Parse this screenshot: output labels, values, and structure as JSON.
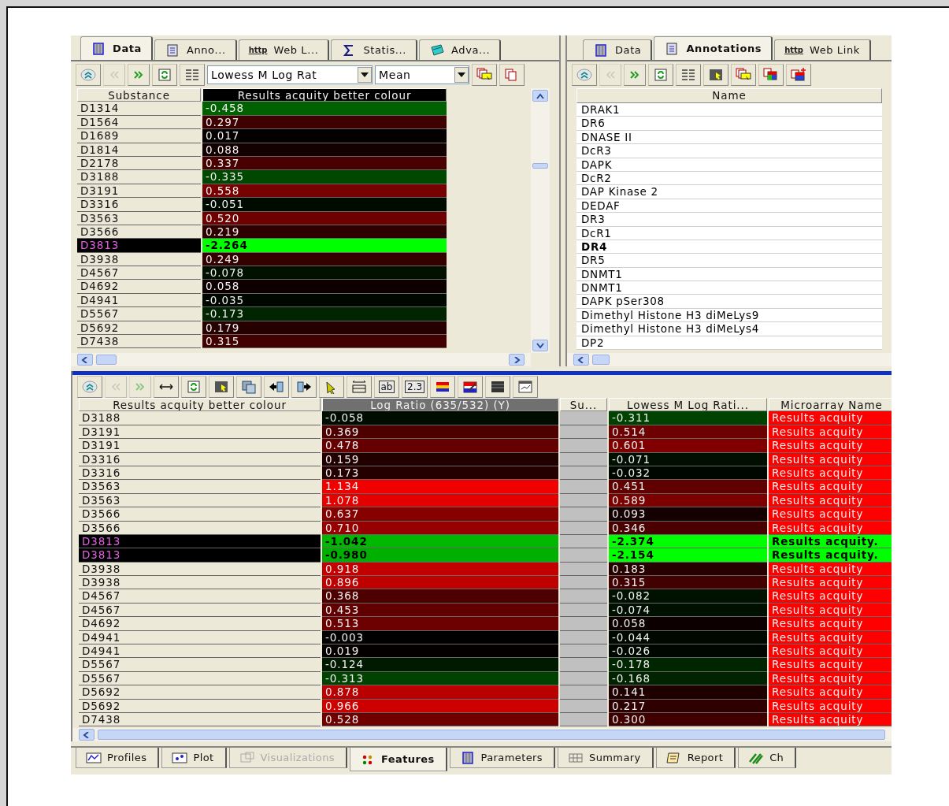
{
  "top_left": {
    "tabs": [
      {
        "label": "Data",
        "selected": true
      },
      {
        "label": "Anno...",
        "selected": false
      },
      {
        "label": "Web L...",
        "badge": "http",
        "selected": false
      },
      {
        "label": "Statis...",
        "selected": false
      },
      {
        "label": "Adva...",
        "selected": false
      }
    ],
    "toolbar": [
      {
        "kind": "expand",
        "disabled": false
      },
      {
        "kind": "prev",
        "disabled": true
      },
      {
        "kind": "next",
        "disabled": false
      },
      {
        "kind": "refresh",
        "disabled": false
      },
      {
        "kind": "columns",
        "disabled": false
      },
      {
        "kind": "select",
        "value": "Lowess M Log Rat",
        "disabled": false
      },
      {
        "kind": "select",
        "value": "Mean",
        "disabled": false
      },
      {
        "kind": "cards-filter",
        "disabled": false
      },
      {
        "kind": "cards",
        "disabled": false
      }
    ],
    "columns": [
      {
        "label": "Substance"
      },
      {
        "label": "Results acquity better colour",
        "color": "#000000"
      }
    ],
    "rows": [
      {
        "substance": "D1314",
        "value": "-0.458",
        "color": "#006100",
        "selected": false
      },
      {
        "substance": "D1564",
        "value": "0.297",
        "color": "#3f0000",
        "selected": false
      },
      {
        "substance": "D1689",
        "value": "0.017",
        "color": "#040000",
        "selected": false
      },
      {
        "substance": "D1814",
        "value": "0.088",
        "color": "#130000",
        "selected": false
      },
      {
        "substance": "D2178",
        "value": "0.337",
        "color": "#480000",
        "selected": false
      },
      {
        "substance": "D3188",
        "value": "-0.335",
        "color": "#004700",
        "selected": false
      },
      {
        "substance": "D3191",
        "value": "0.558",
        "color": "#770000",
        "selected": false
      },
      {
        "substance": "D3316",
        "value": "-0.051",
        "color": "#000b00",
        "selected": false
      },
      {
        "substance": "D3563",
        "value": "0.520",
        "color": "#6f0000",
        "selected": false
      },
      {
        "substance": "D3566",
        "value": "0.219",
        "color": "#2f0000",
        "selected": false
      },
      {
        "substance": "D3813",
        "value": "-2.264",
        "color": "#00ff00",
        "selected": true
      },
      {
        "substance": "D3938",
        "value": "0.249",
        "color": "#350000",
        "selected": false
      },
      {
        "substance": "D4567",
        "value": "-0.078",
        "color": "#001100",
        "selected": false
      },
      {
        "substance": "D4692",
        "value": "0.058",
        "color": "#0c0000",
        "selected": false
      },
      {
        "substance": "D4941",
        "value": "-0.035",
        "color": "#000700",
        "selected": false
      },
      {
        "substance": "D5567",
        "value": "-0.173",
        "color": "#002500",
        "selected": false
      },
      {
        "substance": "D5692",
        "value": "0.179",
        "color": "#260000",
        "selected": false
      },
      {
        "substance": "D7438",
        "value": "0.315",
        "color": "#430000",
        "selected": false
      }
    ]
  },
  "top_right": {
    "tabs": [
      {
        "label": "Data",
        "selected": false
      },
      {
        "label": "Annotations",
        "selected": true
      },
      {
        "label": "Web Link",
        "badge": "http",
        "selected": false
      }
    ],
    "toolbar": [
      {
        "kind": "expand",
        "disabled": false
      },
      {
        "kind": "prev",
        "disabled": true
      },
      {
        "kind": "next",
        "disabled": false
      },
      {
        "kind": "refresh",
        "disabled": false
      },
      {
        "kind": "columns",
        "disabled": false
      },
      {
        "kind": "column-pick",
        "disabled": false
      },
      {
        "kind": "cards-filter",
        "disabled": false
      },
      {
        "kind": "cards-color",
        "disabled": false
      },
      {
        "kind": "cards-color-add",
        "disabled": false
      }
    ],
    "column": "Name",
    "rows": [
      {
        "name": "DRAK1",
        "selected": false
      },
      {
        "name": "DR6",
        "selected": false
      },
      {
        "name": "DNASE II",
        "selected": false
      },
      {
        "name": "DcR3",
        "selected": false
      },
      {
        "name": "DAPK",
        "selected": false
      },
      {
        "name": "DcR2",
        "selected": false
      },
      {
        "name": "DAP Kinase 2",
        "selected": false
      },
      {
        "name": "DEDAF",
        "selected": false
      },
      {
        "name": "DR3",
        "selected": false
      },
      {
        "name": "DcR1",
        "selected": false
      },
      {
        "name": "DR4",
        "selected": true
      },
      {
        "name": "DR5",
        "selected": false
      },
      {
        "name": "DNMT1",
        "selected": false
      },
      {
        "name": "DNMT1",
        "selected": false
      },
      {
        "name": "DAPK pSer308",
        "selected": false
      },
      {
        "name": "Dimethyl Histone H3 diMeLys9",
        "selected": false
      },
      {
        "name": "Dimethyl Histone H3 diMeLys4",
        "selected": false
      },
      {
        "name": "DP2",
        "selected": false
      }
    ]
  },
  "bottom": {
    "toolbar": [
      {
        "kind": "expand",
        "disabled": false
      },
      {
        "kind": "prev",
        "disabled": true
      },
      {
        "kind": "next",
        "disabled": true
      },
      {
        "kind": "arrows",
        "disabled": false
      },
      {
        "kind": "refresh",
        "disabled": false
      },
      {
        "kind": "column-pick",
        "disabled": false
      },
      {
        "kind": "copy",
        "disabled": false
      },
      {
        "kind": "move-left",
        "disabled": false
      },
      {
        "kind": "move-right",
        "disabled": false
      },
      {
        "kind": "pointer",
        "disabled": false
      },
      {
        "kind": "fit-width",
        "disabled": false
      },
      {
        "kind": "label",
        "text": "ab",
        "disabled": false
      },
      {
        "kind": "label",
        "text": "2.3",
        "disabled": false
      },
      {
        "kind": "colors",
        "disabled": false
      },
      {
        "kind": "pen",
        "disabled": false
      },
      {
        "kind": "dark-rows",
        "disabled": false
      },
      {
        "kind": "chart",
        "disabled": false
      }
    ],
    "columns": [
      {
        "label": "Results acquity better colour"
      },
      {
        "label": "Log Ratio (635/532) (Y)",
        "color": "#707070"
      },
      {
        "label": "Su..."
      },
      {
        "label": "Lowess M Log Rati..."
      },
      {
        "label": "Microarray Name"
      }
    ],
    "rows": [
      {
        "name": "D3188",
        "log_ratio": {
          "text": "-0.058",
          "color": "#000c00"
        },
        "lowess": {
          "text": "-0.311",
          "color": "#004200"
        },
        "microarray": {
          "text": "Results acquity",
          "color": "#ff0000"
        },
        "selected": false
      },
      {
        "name": "D3191",
        "log_ratio": {
          "text": "0.369",
          "color": "#4e0000"
        },
        "lowess": {
          "text": "0.514",
          "color": "#6d0000"
        },
        "microarray": {
          "text": "Results acquity",
          "color": "#ff0000"
        },
        "selected": false
      },
      {
        "name": "D3191",
        "log_ratio": {
          "text": "0.478",
          "color": "#660000"
        },
        "lowess": {
          "text": "0.601",
          "color": "#800000"
        },
        "microarray": {
          "text": "Results acquity",
          "color": "#ff0000"
        },
        "selected": false
      },
      {
        "name": "D3316",
        "log_ratio": {
          "text": "0.159",
          "color": "#220000"
        },
        "lowess": {
          "text": "-0.071",
          "color": "#000f00"
        },
        "microarray": {
          "text": "Results acquity",
          "color": "#ff0000"
        },
        "selected": false
      },
      {
        "name": "D3316",
        "log_ratio": {
          "text": "0.173",
          "color": "#250000"
        },
        "lowess": {
          "text": "-0.032",
          "color": "#000700"
        },
        "microarray": {
          "text": "Results acquity",
          "color": "#ff0000"
        },
        "selected": false
      },
      {
        "name": "D3563",
        "log_ratio": {
          "text": "1.134",
          "color": "#f10000"
        },
        "lowess": {
          "text": "0.451",
          "color": "#600000"
        },
        "microarray": {
          "text": "Results acquity",
          "color": "#ff0000"
        },
        "selected": false
      },
      {
        "name": "D3563",
        "log_ratio": {
          "text": "1.078",
          "color": "#e50000"
        },
        "lowess": {
          "text": "0.589",
          "color": "#7d0000"
        },
        "microarray": {
          "text": "Results acquity",
          "color": "#ff0000"
        },
        "selected": false
      },
      {
        "name": "D3566",
        "log_ratio": {
          "text": "0.637",
          "color": "#870000"
        },
        "lowess": {
          "text": "0.093",
          "color": "#140000"
        },
        "microarray": {
          "text": "Results acquity",
          "color": "#ff0000"
        },
        "selected": false
      },
      {
        "name": "D3566",
        "log_ratio": {
          "text": "0.710",
          "color": "#970000"
        },
        "lowess": {
          "text": "0.346",
          "color": "#4a0000"
        },
        "microarray": {
          "text": "Results acquity",
          "color": "#ff0000"
        },
        "selected": false
      },
      {
        "name": "D3813",
        "log_ratio": {
          "text": "-1.042",
          "color": "#00b800"
        },
        "lowess": {
          "text": "-2.374",
          "color": "#00ff00"
        },
        "microarray": {
          "text": "Results acquity.",
          "color": "#00ff00"
        },
        "selected": true
      },
      {
        "name": "D3813",
        "log_ratio": {
          "text": "-0.980",
          "color": "#00b000"
        },
        "lowess": {
          "text": "-2.154",
          "color": "#00ff00"
        },
        "microarray": {
          "text": "Results acquity.",
          "color": "#00ff00"
        },
        "selected": true
      },
      {
        "name": "D3938",
        "log_ratio": {
          "text": "0.918",
          "color": "#c30000"
        },
        "lowess": {
          "text": "0.183",
          "color": "#270000"
        },
        "microarray": {
          "text": "Results acquity",
          "color": "#ff0000"
        },
        "selected": false
      },
      {
        "name": "D3938",
        "log_ratio": {
          "text": "0.896",
          "color": "#be0000"
        },
        "lowess": {
          "text": "0.315",
          "color": "#430000"
        },
        "microarray": {
          "text": "Results acquity",
          "color": "#ff0000"
        },
        "selected": false
      },
      {
        "name": "D4567",
        "log_ratio": {
          "text": "0.368",
          "color": "#4e0000"
        },
        "lowess": {
          "text": "-0.082",
          "color": "#001100"
        },
        "microarray": {
          "text": "Results acquity",
          "color": "#ff0000"
        },
        "selected": false
      },
      {
        "name": "D4567",
        "log_ratio": {
          "text": "0.453",
          "color": "#600000"
        },
        "lowess": {
          "text": "-0.074",
          "color": "#001000"
        },
        "microarray": {
          "text": "Results acquity",
          "color": "#ff0000"
        },
        "selected": false
      },
      {
        "name": "D4692",
        "log_ratio": {
          "text": "0.513",
          "color": "#6d0000"
        },
        "lowess": {
          "text": "0.058",
          "color": "#0c0000"
        },
        "microarray": {
          "text": "Results acquity",
          "color": "#ff0000"
        },
        "selected": false
      },
      {
        "name": "D4941",
        "log_ratio": {
          "text": "-0.003",
          "color": "#000100"
        },
        "lowess": {
          "text": "-0.044",
          "color": "#000900"
        },
        "microarray": {
          "text": "Results acquity",
          "color": "#ff0000"
        },
        "selected": false
      },
      {
        "name": "D4941",
        "log_ratio": {
          "text": "0.019",
          "color": "#040000"
        },
        "lowess": {
          "text": "-0.026",
          "color": "#000600"
        },
        "microarray": {
          "text": "Results acquity",
          "color": "#ff0000"
        },
        "selected": false
      },
      {
        "name": "D5567",
        "log_ratio": {
          "text": "-0.124",
          "color": "#001a00"
        },
        "lowess": {
          "text": "-0.178",
          "color": "#002600"
        },
        "microarray": {
          "text": "Results acquity",
          "color": "#ff0000"
        },
        "selected": false
      },
      {
        "name": "D5567",
        "log_ratio": {
          "text": "-0.313",
          "color": "#004300"
        },
        "lowess": {
          "text": "-0.168",
          "color": "#002400"
        },
        "microarray": {
          "text": "Results acquity",
          "color": "#ff0000"
        },
        "selected": false
      },
      {
        "name": "D5692",
        "log_ratio": {
          "text": "0.878",
          "color": "#ba0000"
        },
        "lowess": {
          "text": "0.141",
          "color": "#1e0000"
        },
        "microarray": {
          "text": "Results acquity",
          "color": "#ff0000"
        },
        "selected": false
      },
      {
        "name": "D5692",
        "log_ratio": {
          "text": "0.966",
          "color": "#cd0000"
        },
        "lowess": {
          "text": "0.217",
          "color": "#2e0000"
        },
        "microarray": {
          "text": "Results acquity",
          "color": "#ff0000"
        },
        "selected": false
      },
      {
        "name": "D7438",
        "log_ratio": {
          "text": "0.528",
          "color": "#700000"
        },
        "lowess": {
          "text": "0.300",
          "color": "#400000"
        },
        "microarray": {
          "text": "Results acquity",
          "color": "#ff0000"
        },
        "selected": false
      }
    ]
  },
  "bottom_tabs": [
    {
      "label": "Profiles",
      "selected": false,
      "disabled": false
    },
    {
      "label": "Plot",
      "selected": false,
      "disabled": false
    },
    {
      "label": "Visualizations",
      "selected": false,
      "disabled": true
    },
    {
      "label": "Features",
      "selected": true,
      "disabled": false
    },
    {
      "label": "Parameters",
      "selected": false,
      "disabled": false
    },
    {
      "label": "Summary",
      "selected": false,
      "disabled": false
    },
    {
      "label": "Report",
      "selected": false,
      "disabled": false
    },
    {
      "label": "Ch",
      "selected": false,
      "disabled": false
    }
  ]
}
